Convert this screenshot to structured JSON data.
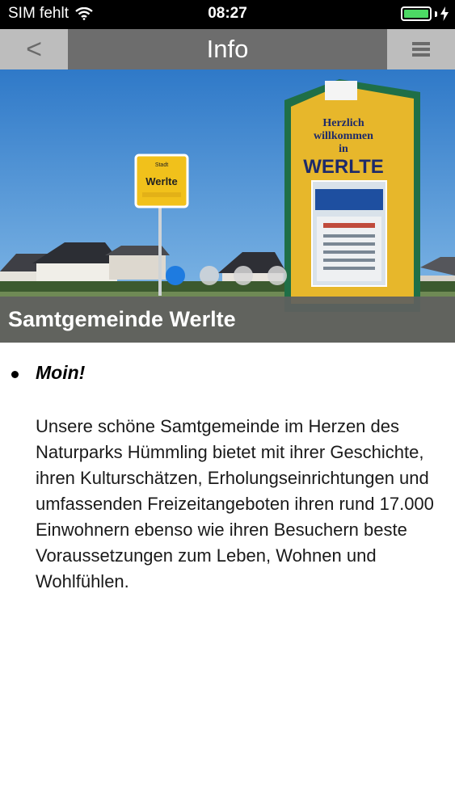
{
  "status_bar": {
    "carrier": "SIM fehlt",
    "time": "08:27"
  },
  "navbar": {
    "back_label": "<",
    "title": "Info"
  },
  "hero": {
    "caption": "Samtgemeinde Werlte",
    "slide_count": 4,
    "active_slide": 1,
    "sign_text": {
      "line1": "Herzlich",
      "line2": "willkommen",
      "line3": "in",
      "town": "WERLTE",
      "place_sign_small": "Stadt",
      "place_sign_town": "Werlte"
    }
  },
  "content": {
    "heading": "Moin!",
    "paragraph": "Unsere schöne Samtgemeinde im Herzen des Naturparks Hümmling bietet mit ihrer Geschichte, ihren Kulturschätzen, Erholungseinrichtungen und umfassenden Freizeitangeboten ihren rund 17.000 Einwohnern ebenso wie ihren Besuchern beste Voraussetzungen zum Leben, Wohnen und Wohlfühlen."
  },
  "colors": {
    "navbar": "#6d6d6d",
    "nav_buttons": "#bdbdbd",
    "dot_active": "#1e7be0",
    "battery": "#4cd964"
  }
}
